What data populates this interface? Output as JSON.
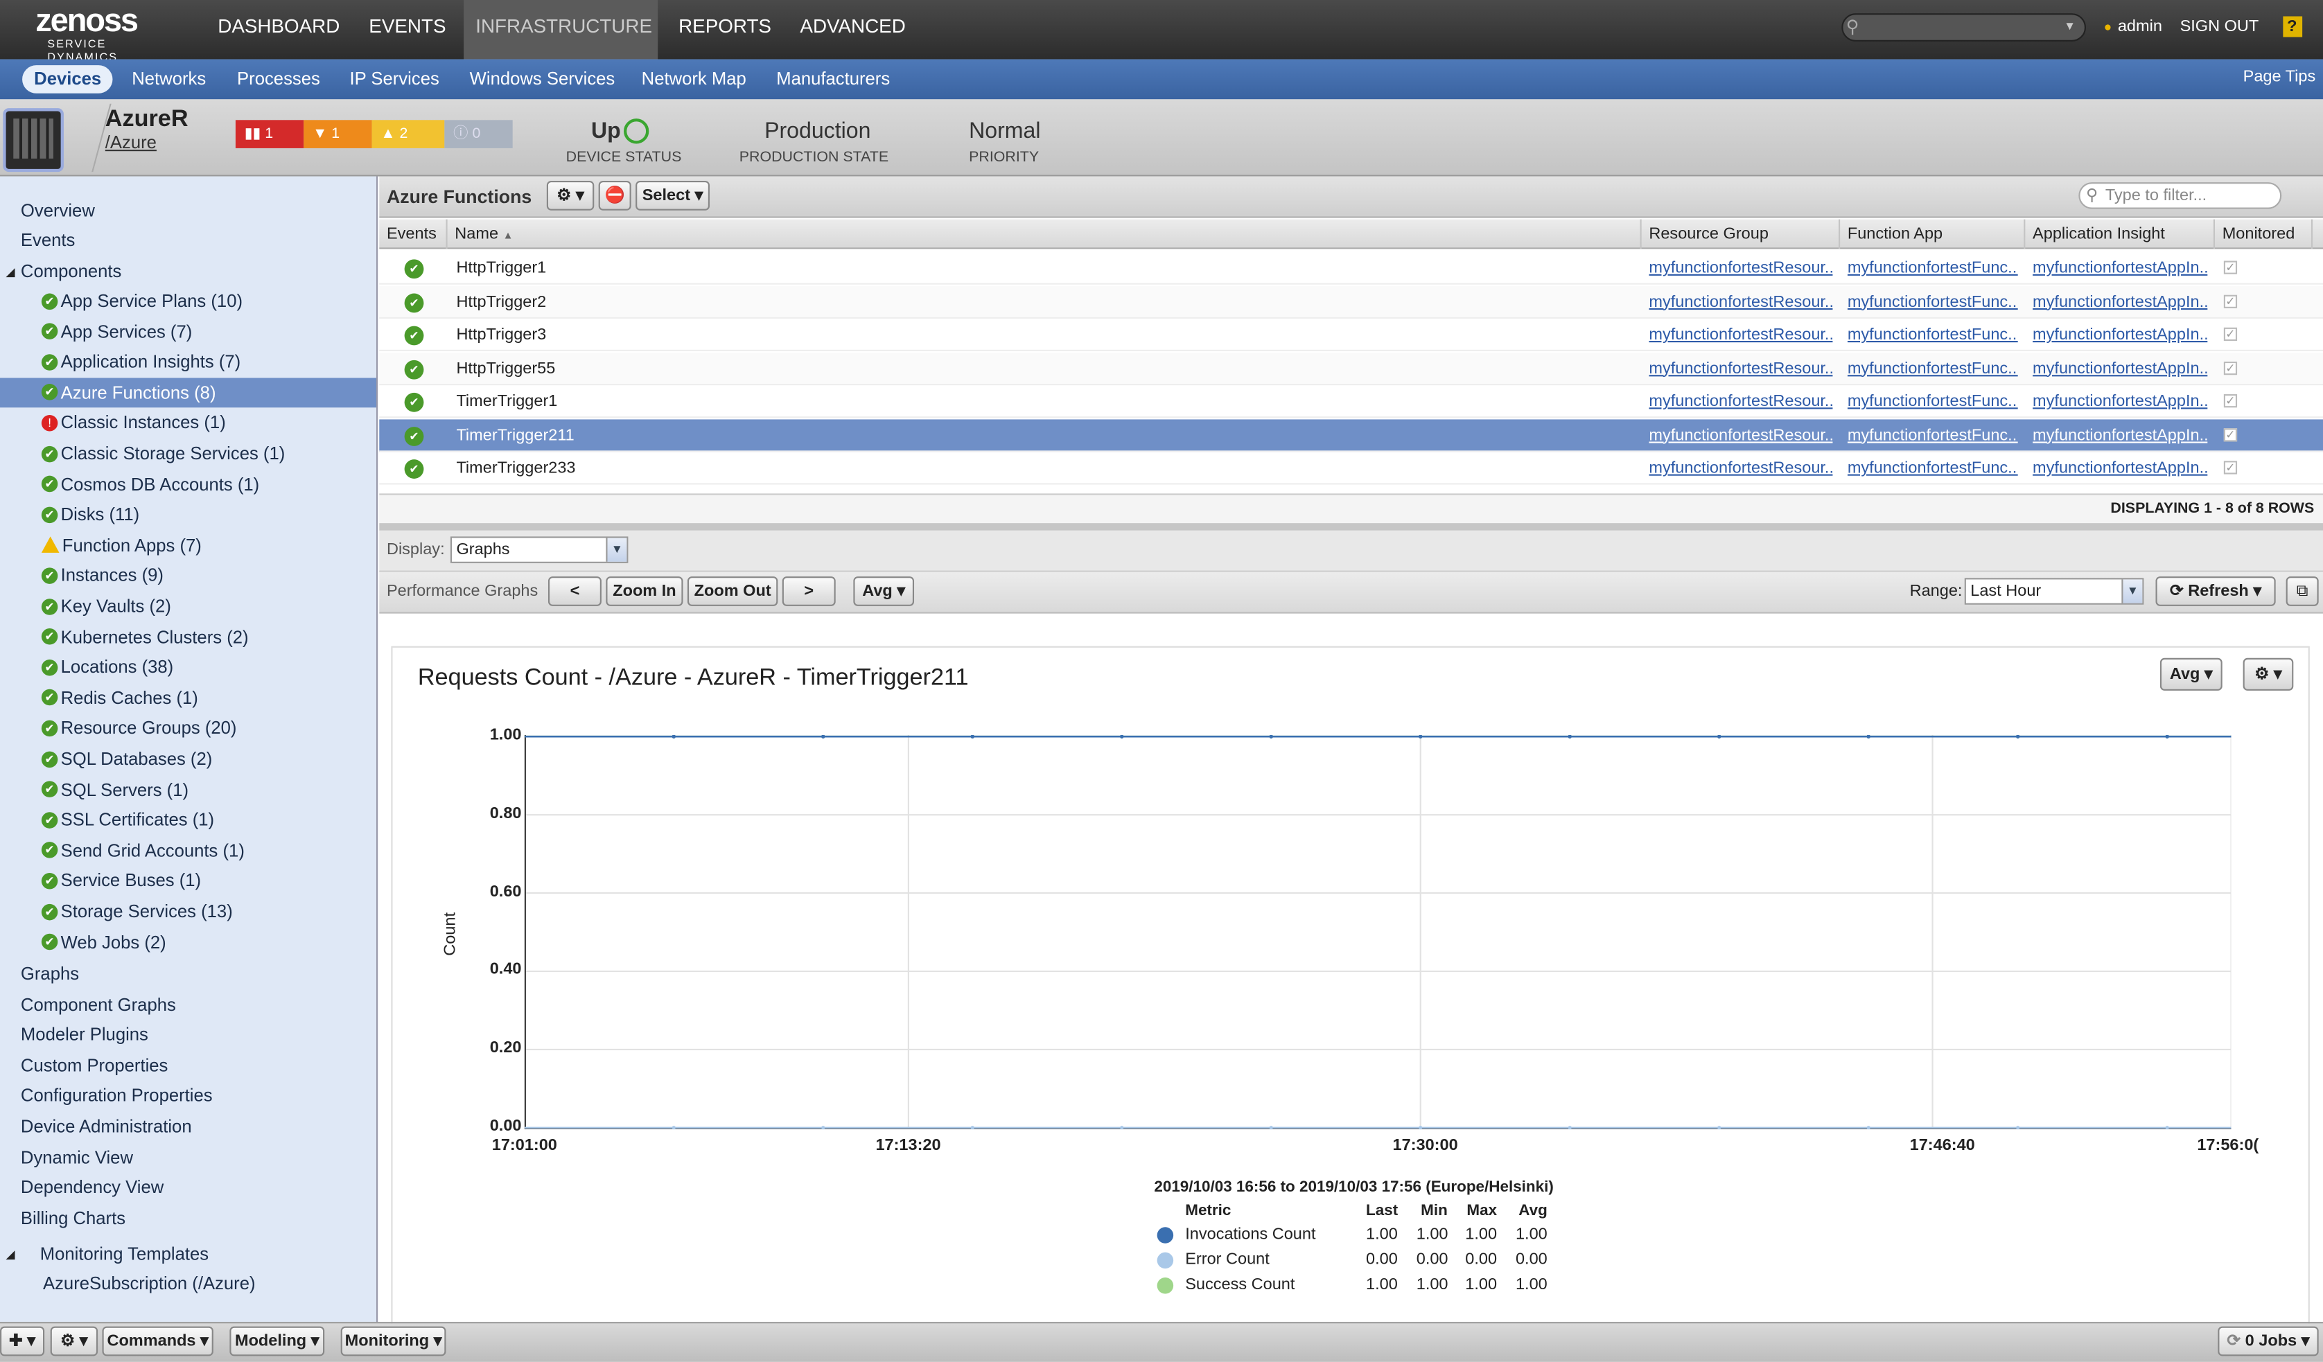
{
  "logo": {
    "name": "zenoss",
    "tagline": "SERVICE DYNAMICS"
  },
  "topnav": [
    "DASHBOARD",
    "EVENTS",
    "INFRASTRUCTURE",
    "REPORTS",
    "ADVANCED"
  ],
  "topnav_active": "INFRASTRUCTURE",
  "user": {
    "name": "admin",
    "signout": "SIGN OUT",
    "help": "?"
  },
  "subnav": [
    "Devices",
    "Networks",
    "Processes",
    "IP Services",
    "Windows Services",
    "Network Map",
    "Manufacturers"
  ],
  "subnav_active": "Devices",
  "page_tips": "Page Tips",
  "device": {
    "name": "AzureR",
    "path": "/Azure",
    "events": {
      "critical": "1",
      "error": "1",
      "warning": "2",
      "info": "0"
    },
    "status_value": "Up",
    "status_label": "DEVICE STATUS",
    "production_value": "Production",
    "production_label": "PRODUCTION STATE",
    "priority_value": "Normal",
    "priority_label": "PRIORITY"
  },
  "sidebar": {
    "top": [
      "Overview",
      "Events",
      "Components"
    ],
    "components": [
      {
        "label": "App Service Plans (10)",
        "status": "ok"
      },
      {
        "label": "App Services (7)",
        "status": "ok"
      },
      {
        "label": "Application Insights (7)",
        "status": "ok"
      },
      {
        "label": "Azure Functions (8)",
        "status": "ok",
        "selected": true
      },
      {
        "label": "Classic Instances (1)",
        "status": "err"
      },
      {
        "label": "Classic Storage Services (1)",
        "status": "ok"
      },
      {
        "label": "Cosmos DB Accounts (1)",
        "status": "ok"
      },
      {
        "label": "Disks (11)",
        "status": "ok"
      },
      {
        "label": "Function Apps (7)",
        "status": "warn"
      },
      {
        "label": "Instances (9)",
        "status": "ok"
      },
      {
        "label": "Key Vaults (2)",
        "status": "ok"
      },
      {
        "label": "Kubernetes Clusters (2)",
        "status": "ok"
      },
      {
        "label": "Locations (38)",
        "status": "ok"
      },
      {
        "label": "Redis Caches (1)",
        "status": "ok"
      },
      {
        "label": "Resource Groups (20)",
        "status": "ok"
      },
      {
        "label": "SQL Databases (2)",
        "status": "ok"
      },
      {
        "label": "SQL Servers (1)",
        "status": "ok"
      },
      {
        "label": "SSL Certificates (1)",
        "status": "ok"
      },
      {
        "label": "Send Grid Accounts (1)",
        "status": "ok"
      },
      {
        "label": "Service Buses (1)",
        "status": "ok"
      },
      {
        "label": "Storage Services (13)",
        "status": "ok"
      },
      {
        "label": "Web Jobs (2)",
        "status": "ok"
      }
    ],
    "bottom": [
      "Graphs",
      "Component Graphs",
      "Modeler Plugins",
      "Custom Properties",
      "Configuration Properties",
      "Device Administration",
      "Dynamic View",
      "Dependency View",
      "Billing Charts"
    ],
    "monitoring_templates": "Monitoring Templates",
    "template_item": "AzureSubscription (/Azure)"
  },
  "grid": {
    "title": "Azure Functions",
    "select_label": "Select",
    "filter_placeholder": "Type to filter...",
    "columns": [
      "Events",
      "Name",
      "Resource Group",
      "Function App",
      "Application Insight",
      "Monitored"
    ],
    "rows": [
      {
        "name": "HttpTrigger1",
        "rg": "myfunctionfortestResour...",
        "app": "myfunctionfortestFunc...",
        "ai": "myfunctionfortestAppIn...",
        "selected": false
      },
      {
        "name": "HttpTrigger2",
        "rg": "myfunctionfortestResour...",
        "app": "myfunctionfortestFunc...",
        "ai": "myfunctionfortestAppIn...",
        "selected": false
      },
      {
        "name": "HttpTrigger3",
        "rg": "myfunctionfortestResour...",
        "app": "myfunctionfortestFunc...",
        "ai": "myfunctionfortestAppIn...",
        "selected": false
      },
      {
        "name": "HttpTrigger55",
        "rg": "myfunctionfortestResour...",
        "app": "myfunctionfortestFunc...",
        "ai": "myfunctionfortestAppIn...",
        "selected": false
      },
      {
        "name": "TimerTrigger1",
        "rg": "myfunctionfortestResour...",
        "app": "myfunctionfortestFunc...",
        "ai": "myfunctionfortestAppIn...",
        "selected": false
      },
      {
        "name": "TimerTrigger211",
        "rg": "myfunctionfortestResour...",
        "app": "myfunctionfortestFunc...",
        "ai": "myfunctionfortestAppIn...",
        "selected": true
      },
      {
        "name": "TimerTrigger233",
        "rg": "myfunctionfortestResour...",
        "app": "myfunctionfortestFunc...",
        "ai": "myfunctionfortestAppIn...",
        "selected": false
      }
    ],
    "footer": "DISPLAYING 1 - 8 of 8 ROWS"
  },
  "display": {
    "label": "Display:",
    "value": "Graphs"
  },
  "perf": {
    "label": "Performance Graphs",
    "prev": "<",
    "zoom_in": "Zoom In",
    "zoom_out": "Zoom Out",
    "next": ">",
    "avg": "Avg",
    "range_label": "Range:",
    "range_value": "Last Hour",
    "refresh": "Refresh"
  },
  "graph": {
    "title": "Requests Count - /Azure - AzureR - TimerTrigger211",
    "avg_btn": "Avg",
    "range_text": "2019/10/03 16:56 to 2019/10/03 17:56 (Europe/Helsinki)",
    "legend_headers": [
      "Metric",
      "Last",
      "Min",
      "Max",
      "Avg"
    ]
  },
  "chart_data": {
    "type": "line",
    "title": "Requests Count - /Azure - AzureR - TimerTrigger211",
    "ylabel": "Count",
    "ylim": [
      0,
      1
    ],
    "yticks": [
      "0.00",
      "0.20",
      "0.40",
      "0.60",
      "0.80",
      "1.00"
    ],
    "xticks": [
      "17:01:00",
      "17:13:20",
      "17:30:00",
      "17:46:40",
      "17:56:0("
    ],
    "series": [
      {
        "name": "Invocations Count",
        "color": "#3a6fb0",
        "last": "1.00",
        "min": "1.00",
        "max": "1.00",
        "avg": "1.00",
        "value": 1
      },
      {
        "name": "Error Count",
        "color": "#a9c8e8",
        "last": "0.00",
        "min": "0.00",
        "max": "0.00",
        "avg": "0.00",
        "value": 0
      },
      {
        "name": "Success Count",
        "color": "#9fd68a",
        "last": "1.00",
        "min": "1.00",
        "max": "1.00",
        "avg": "1.00",
        "value": 1
      }
    ]
  },
  "bottombar": {
    "commands": "Commands",
    "modeling": "Modeling",
    "monitoring": "Monitoring",
    "jobs": "0 Jobs"
  }
}
